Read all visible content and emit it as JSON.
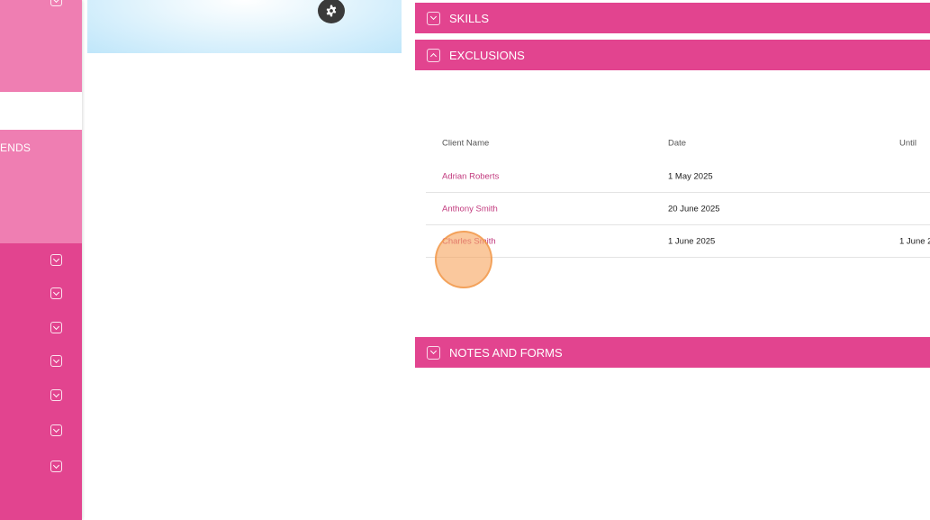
{
  "sidebar": {
    "partial_label": "ENDS",
    "chevron_count": 8
  },
  "accordions": {
    "skills": "SKILLS",
    "exclusions": "EXCLUSIONS",
    "notes_forms": "NOTES AND FORMS"
  },
  "exclusions_table": {
    "columns": [
      "Client Name",
      "Date",
      "Until"
    ],
    "rows": [
      {
        "client": "Adrian Roberts",
        "date": "1 May 2025",
        "until": ""
      },
      {
        "client": "Anthony Smith",
        "date": "20 June 2025",
        "until": ""
      },
      {
        "client": "Charles Smith",
        "date": "1 June 2025",
        "until": "1 June 2"
      }
    ]
  },
  "colors": {
    "accent": "#e2448f",
    "accent_light": "#ef7eb2",
    "link": "#c23a7e"
  },
  "icons": {
    "settings": "gear-icon",
    "expand": "chevron-down-icon",
    "collapse": "chevron-up-icon"
  }
}
